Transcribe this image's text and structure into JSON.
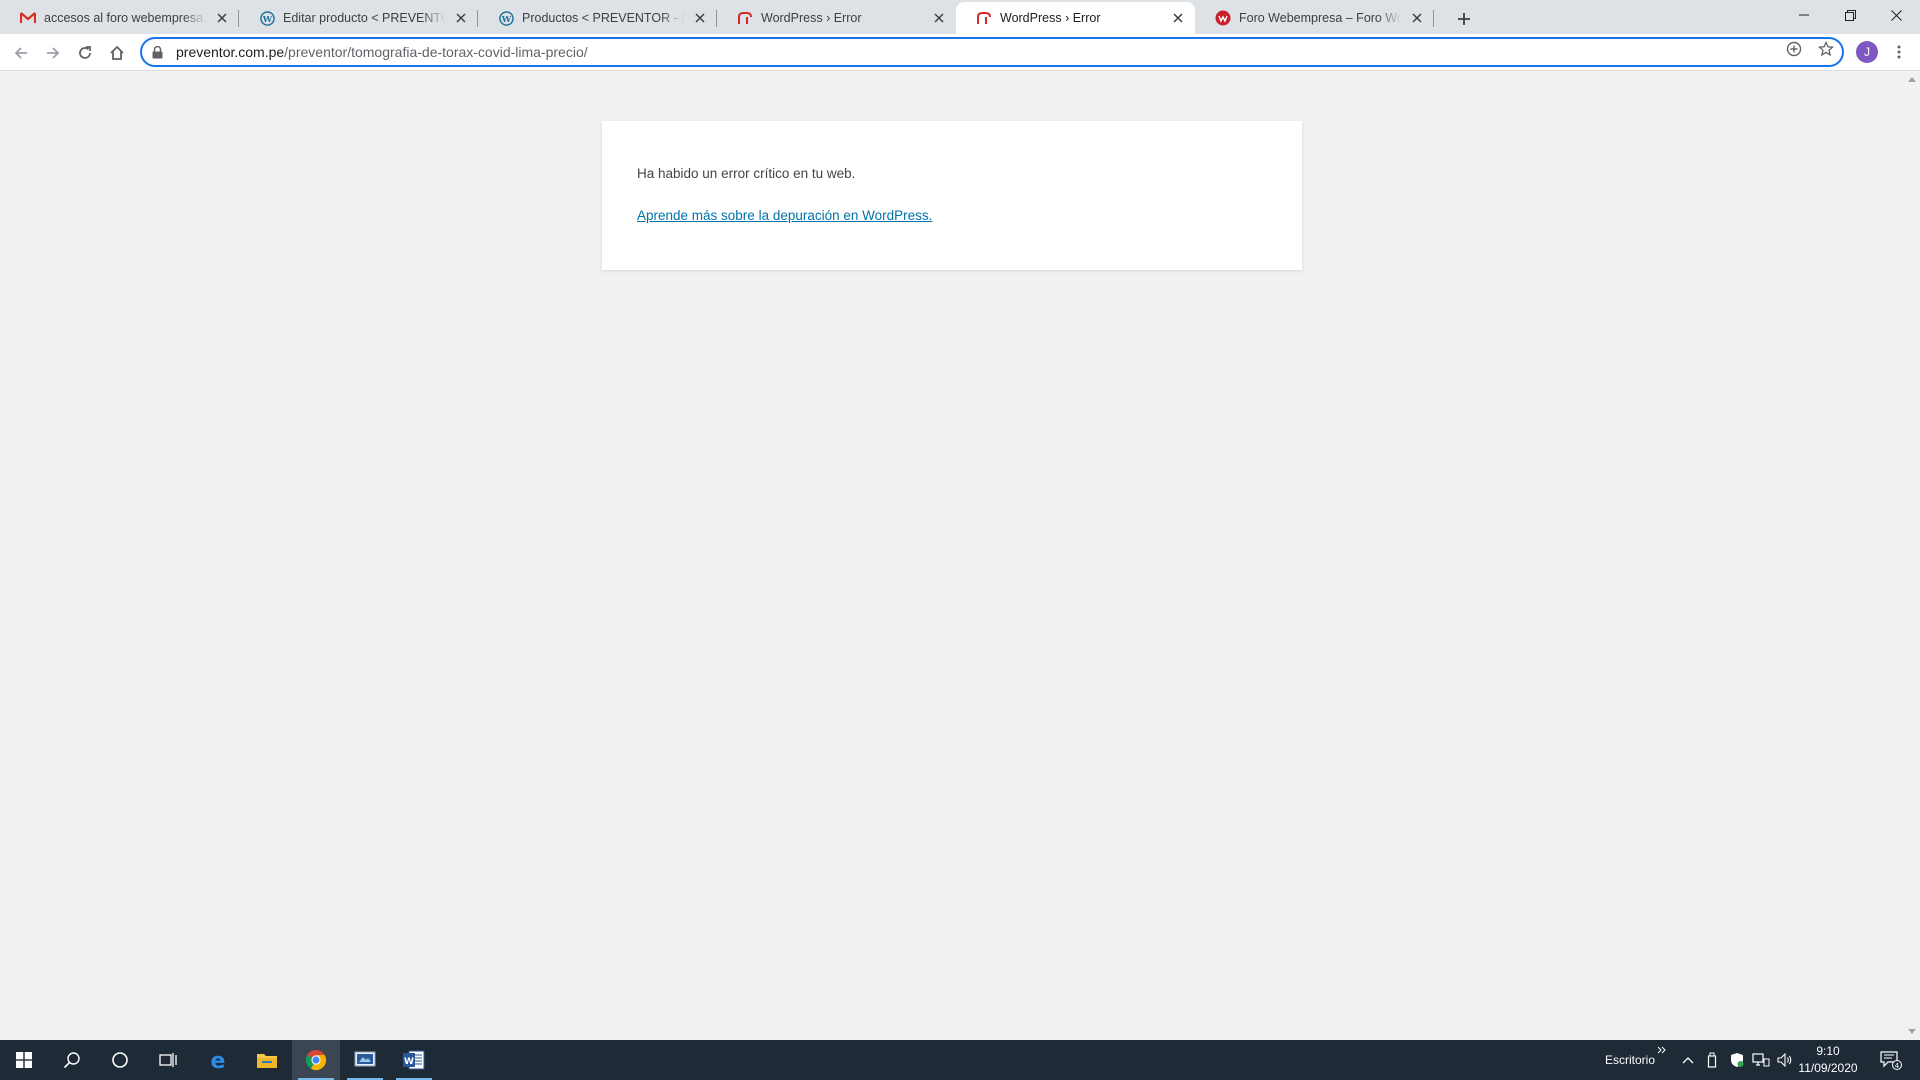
{
  "browser": {
    "tabs": [
      {
        "title": "accesos al foro webempresa - rafa",
        "favicon": "gmail-icon",
        "active": false
      },
      {
        "title": "Editar producto < PREVENTOR - Ecografía",
        "favicon": "wordpress-icon",
        "active": false
      },
      {
        "title": "Productos < PREVENTOR - Ecografía",
        "favicon": "wordpress-icon",
        "active": false
      },
      {
        "title": "WordPress › Error",
        "favicon": "webempresa-red-icon",
        "active": false
      },
      {
        "title": "WordPress › Error",
        "favicon": "webempresa-red-icon",
        "active": true
      },
      {
        "title": "Foro Webempresa – Foro WordPress",
        "favicon": "webempresa-circle-icon",
        "active": false
      }
    ],
    "address": {
      "domain": "preventor.com.pe",
      "path": "/preventor/tomografia-de-torax-covid-lima-precio/"
    },
    "profile_initial": "J",
    "colors": {
      "accent": "#1a73e8",
      "avatar": "#7e57c2"
    }
  },
  "page": {
    "message": "Ha habido un error crítico en tu web.",
    "link_text": "Aprende más sobre la depuración en WordPress.",
    "link_color": "#0073aa"
  },
  "taskbar": {
    "desktop_label": "Escritorio",
    "time": "9:10",
    "date": "11/09/2020",
    "notification_count": "4"
  }
}
